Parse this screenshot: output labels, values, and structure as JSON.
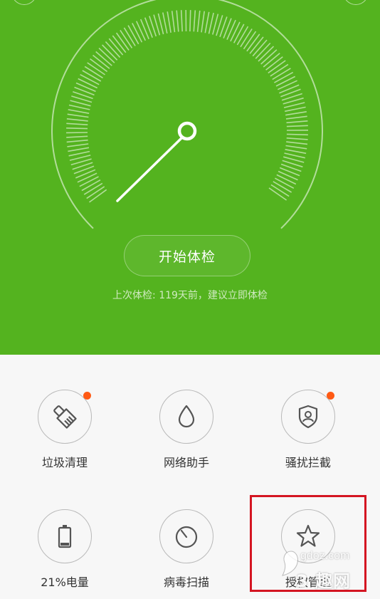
{
  "hero": {
    "start_button": "开始体检",
    "last_check": "上次体检: 119天前，建议立即体检",
    "bg_color": "#54b31f"
  },
  "tools": [
    {
      "label": "垃圾清理",
      "icon": "broom-icon",
      "badge": true
    },
    {
      "label": "网络助手",
      "icon": "droplet-icon",
      "badge": false
    },
    {
      "label": "骚扰拦截",
      "icon": "shield-user-icon",
      "badge": true
    },
    {
      "label": "21%电量",
      "icon": "battery-icon",
      "badge": false
    },
    {
      "label": "病毒扫描",
      "icon": "scan-dial-icon",
      "badge": false
    },
    {
      "label": "授权管理",
      "icon": "star-icon",
      "badge": false
    }
  ],
  "badge_color": "#ff5a14",
  "highlight_color": "#d41522",
  "watermark": {
    "url": "gdoz.com",
    "text": "3 趣网"
  }
}
